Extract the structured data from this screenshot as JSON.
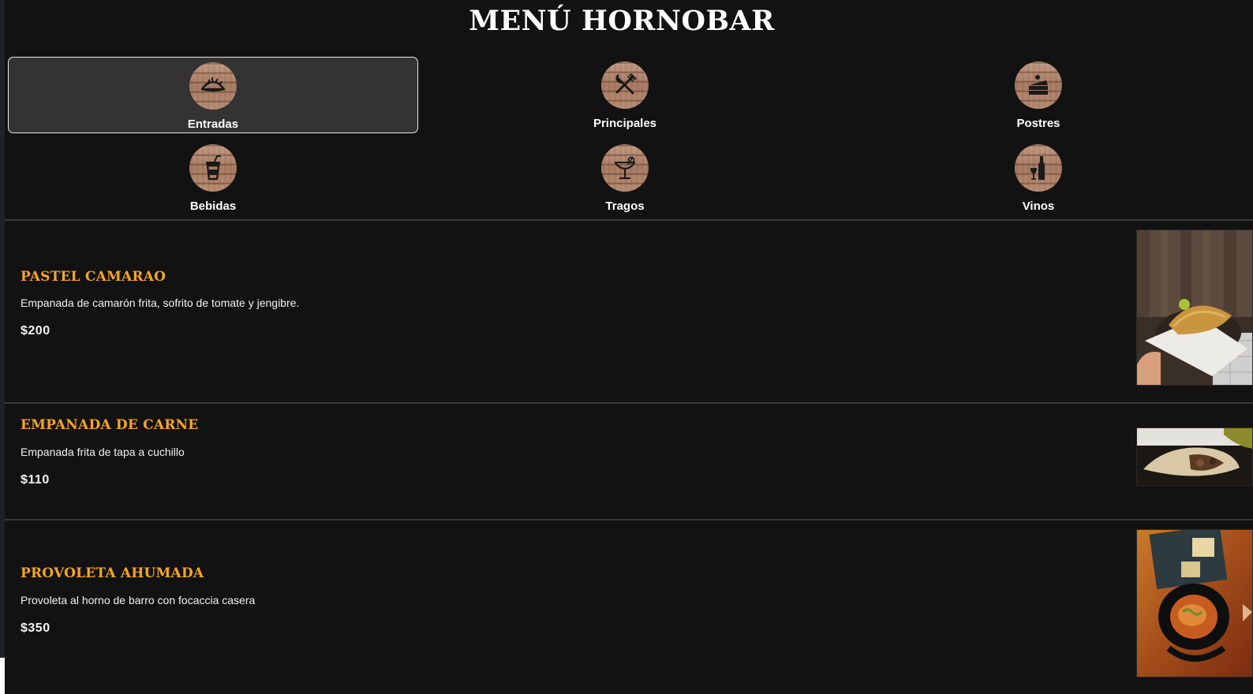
{
  "title": "MENÚ HORNOBAR",
  "categories": [
    {
      "label": "Entradas",
      "icon": "empanada-icon",
      "active": true
    },
    {
      "label": "Principales",
      "icon": "fork-knife-icon",
      "active": false
    },
    {
      "label": "Postres",
      "icon": "cake-slice-icon",
      "active": false
    },
    {
      "label": "Bebidas",
      "icon": "soda-cup-icon",
      "active": false
    },
    {
      "label": "Tragos",
      "icon": "cocktail-glass-icon",
      "active": false
    },
    {
      "label": "Vinos",
      "icon": "wine-bottle-icon",
      "active": false
    }
  ],
  "items": [
    {
      "name": "PASTEL CAMARAO",
      "description": "Empanada de camarón frita, sofrito de tomate y jengibre.",
      "price": "$200"
    },
    {
      "name": "EMPANADA DE CARNE",
      "description": "Empanada frita de tapa a cuchillo",
      "price": "$110"
    },
    {
      "name": "PROVOLETA AHUMADA",
      "description": "Provoleta al horno de barro con focaccia casera",
      "price": "$350"
    }
  ],
  "colors": {
    "accent": "#f5a623",
    "background": "#121212",
    "active_tab": "#333333"
  }
}
